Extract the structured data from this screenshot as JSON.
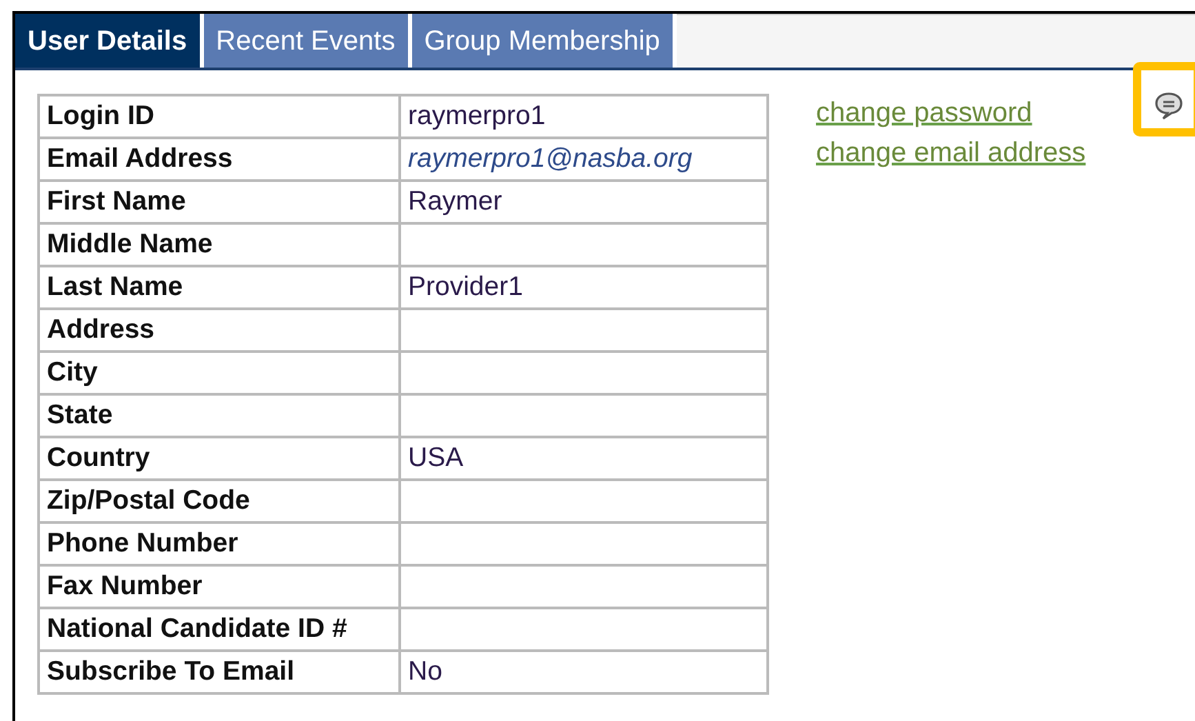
{
  "tabs": [
    {
      "label": "User Details",
      "selected": true
    },
    {
      "label": "Recent Events",
      "selected": false
    },
    {
      "label": "Group Membership",
      "selected": false
    }
  ],
  "details": [
    {
      "label": "Login ID",
      "value": "raymerpro1"
    },
    {
      "label": "Email Address",
      "value": "raymerpro1@nasba.org",
      "kind": "email"
    },
    {
      "label": "First Name",
      "value": "Raymer"
    },
    {
      "label": "Middle Name"
    },
    {
      "label": "Last Name",
      "value": "Provider1"
    },
    {
      "label": "Address"
    },
    {
      "label": "City"
    },
    {
      "label": "State"
    },
    {
      "label": "Country",
      "value": "USA"
    },
    {
      "label": "Zip/Postal Code"
    },
    {
      "label": "Phone Number"
    },
    {
      "label": "Fax Number"
    },
    {
      "label": "National Candidate ID #"
    },
    {
      "label": "Subscribe To Email",
      "value": "No"
    }
  ],
  "links": [
    "change password",
    "change email address"
  ]
}
